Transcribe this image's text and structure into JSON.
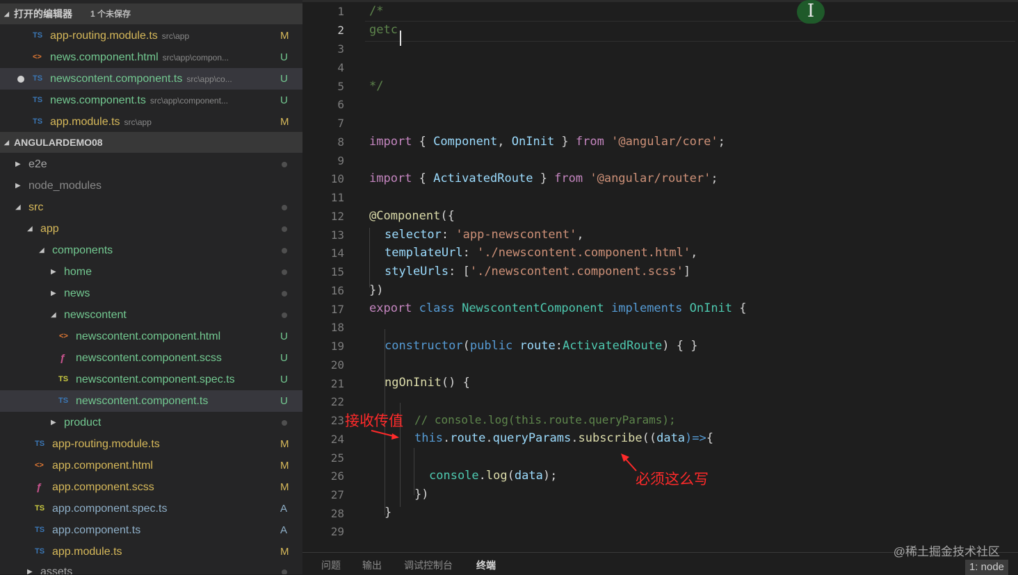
{
  "sidebar": {
    "open_editors": {
      "title": "打开的编辑器",
      "subtitle": "1 个未保存",
      "items": [
        {
          "icon": "TS",
          "name": "app-routing.module.ts",
          "path": "src\\app",
          "status": "M"
        },
        {
          "icon": "<>",
          "name": "news.component.html",
          "path": "src\\app\\compon...",
          "status": "U"
        },
        {
          "icon": "TS",
          "name": "newscontent.component.ts",
          "path": "src\\app\\co...",
          "status": "U"
        },
        {
          "icon": "TS",
          "name": "news.component.ts",
          "path": "src\\app\\component...",
          "status": "U"
        },
        {
          "icon": "TS",
          "name": "app.module.ts",
          "path": "src\\app",
          "status": "M"
        }
      ]
    },
    "project": {
      "title": "ANGULARDEMO08",
      "tree": [
        {
          "label": "e2e"
        },
        {
          "label": "node_modules"
        },
        {
          "label": "src"
        },
        {
          "label": "app"
        },
        {
          "label": "components"
        },
        {
          "label": "home"
        },
        {
          "label": "news"
        },
        {
          "label": "newscontent"
        },
        {
          "icon": "<>",
          "label": "newscontent.component.html",
          "status": "U"
        },
        {
          "icon": "ƒ",
          "label": "newscontent.component.scss",
          "status": "U"
        },
        {
          "icon": "TS",
          "label": "newscontent.component.spec.ts",
          "status": "U"
        },
        {
          "icon": "TS",
          "label": "newscontent.component.ts",
          "status": "U"
        },
        {
          "label": "product"
        },
        {
          "icon": "TS",
          "label": "app-routing.module.ts",
          "status": "M"
        },
        {
          "icon": "<>",
          "label": "app.component.html",
          "status": "M"
        },
        {
          "icon": "ƒ",
          "label": "app.component.scss",
          "status": "M"
        },
        {
          "icon": "TS",
          "label": "app.component.spec.ts",
          "status": "A"
        },
        {
          "icon": "TS",
          "label": "app.component.ts",
          "status": "A"
        },
        {
          "icon": "TS",
          "label": "app.module.ts",
          "status": "M"
        },
        {
          "label": "assets"
        }
      ]
    }
  },
  "editor": {
    "line_numbers": [
      "1",
      "2",
      "3",
      "4",
      "5",
      "6",
      "7",
      "8",
      "9",
      "10",
      "11",
      "12",
      "13",
      "14",
      "15",
      "16",
      "17",
      "18",
      "19",
      "20",
      "21",
      "22",
      "23",
      "24",
      "25",
      "26",
      "27",
      "28",
      "29"
    ],
    "lines": {
      "l1": "/*",
      "l2": "getc",
      "l5": "*/",
      "l8": {
        "import": "import",
        "ob": "{ ",
        "c1": "Component",
        "comma": ", ",
        "c2": "OnInit",
        "cb": " } ",
        "from": "from",
        "str": " '@angular/core'",
        "semi": ";"
      },
      "l10": {
        "import": "import",
        "ob": "{ ",
        "c1": "ActivatedRoute",
        "cb": " } ",
        "from": "from",
        "str": " '@angular/router'",
        "semi": ";"
      },
      "l12": {
        "dec": "@Component",
        "rest": "({"
      },
      "l13": {
        "key": "selector",
        "colon": ": ",
        "str": "'app-newscontent'",
        "end": ","
      },
      "l14": {
        "key": "templateUrl",
        "colon": ": ",
        "str": "'./newscontent.component.html'",
        "end": ","
      },
      "l15": {
        "key": "styleUrls",
        "colon": ": [",
        "str": "'./newscontent.component.scss'",
        "end": "]"
      },
      "l16": "})",
      "l17": {
        "export": "export",
        "class": " class ",
        "name": "NewscontentComponent",
        "impl": " implements ",
        "iface": "OnInit",
        "end": " {"
      },
      "l19": {
        "fn": "constructor",
        "op": "(",
        "pub": "public",
        "sp": " ",
        "param": "route",
        "colon": ":",
        "type": "ActivatedRoute",
        "end": ") { }"
      },
      "l21": {
        "fn": "ngOnInit",
        "end": "() {"
      },
      "l23": "// console.log(this.route.queryParams);",
      "l24": {
        "this": "this",
        "dot1": ".",
        "route": "route",
        "dot2": ".",
        "qp": "queryParams",
        "dot3": ".",
        "sub": "subscribe",
        "p1": "((",
        "data": "data",
        "arrow": ")=>",
        "end": "{"
      },
      "l26": {
        "console": "console",
        "dot": ".",
        "log": "log",
        "open": "(",
        "data": "data",
        "close": ");"
      },
      "l27": "})",
      "l28": "}"
    },
    "annotations": {
      "receive": "接收传值",
      "must": "必须这么写"
    }
  },
  "panel": {
    "tabs": [
      "问题",
      "输出",
      "调试控制台",
      "终端"
    ],
    "terminal_select": "1: node"
  },
  "watermark": "@稀土掘金技术社区",
  "colors": {
    "annotation": "#ff2a2a",
    "keyword": "#c586c0",
    "class": "#4ec9b0",
    "string": "#ce9178"
  }
}
